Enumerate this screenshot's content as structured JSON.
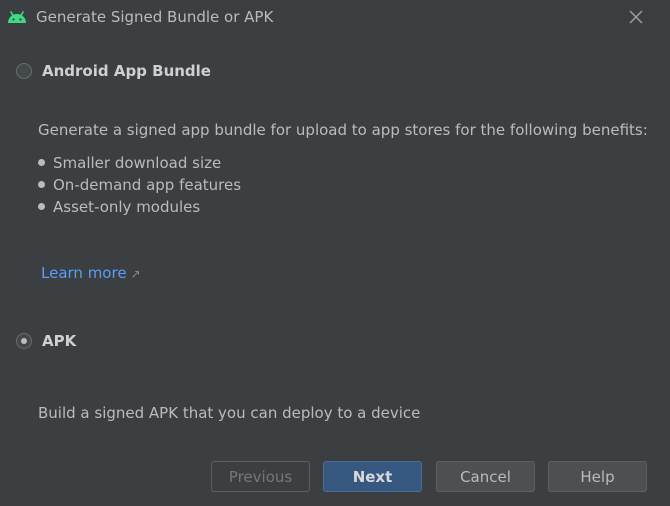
{
  "window": {
    "title": "Generate Signed Bundle or APK",
    "app_icon": "android-icon",
    "close_icon": "close-icon"
  },
  "options": {
    "bundle": {
      "label": "Android App Bundle",
      "selected": false,
      "description": "Generate a signed app bundle for upload to app stores for the following benefits:",
      "benefits": [
        "Smaller download size",
        "On-demand app features",
        "Asset-only modules"
      ],
      "learn_more": "Learn more",
      "learn_more_icon": "external-link-arrow-icon"
    },
    "apk": {
      "label": "APK",
      "selected": true,
      "description": "Build a signed APK that you can deploy to a device"
    }
  },
  "buttons": {
    "previous": "Previous",
    "next": "Next",
    "cancel": "Cancel",
    "help": "Help"
  },
  "colors": {
    "background": "#3c3f41",
    "link": "#589df6",
    "primary_button": "#365880",
    "android_green": "#3ddc84"
  }
}
